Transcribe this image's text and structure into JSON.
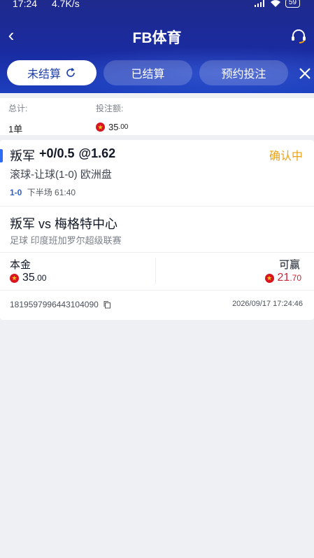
{
  "status_bar": {
    "time": "17:24",
    "speed": "4.7K/s",
    "battery": "59"
  },
  "nav": {
    "title": "FB体育"
  },
  "tabs": [
    {
      "label": "未结算"
    },
    {
      "label": "已结算"
    },
    {
      "label": "预约投注"
    }
  ],
  "summary": {
    "total_label": "总计:",
    "total_value": "1单",
    "amount_label": "投注额:",
    "amount_int": "35",
    "amount_dec": ".00"
  },
  "bet": {
    "selection": "叛军",
    "handicap": "+0/0.5",
    "odds": "@1.62",
    "status": "确认中",
    "market": "滚球-让球(1-0) 欧洲盘",
    "score": "1-0",
    "period": "下半场 61:40",
    "match": "叛军 vs 梅格特中心",
    "league": "足球   印度班加罗尔超级联赛",
    "stake_label": "本金",
    "stake_int": "35",
    "stake_dec": ".00",
    "win_label": "可赢",
    "win_int": "21",
    "win_dec": ".70",
    "order_id": "1819597996443104090",
    "order_time": "2026/09/17 17:24:46"
  },
  "colors": {
    "header": "#1e2a8c",
    "accent": "#2d6cf5",
    "pending": "#e8a317",
    "win": "#c8283a"
  }
}
